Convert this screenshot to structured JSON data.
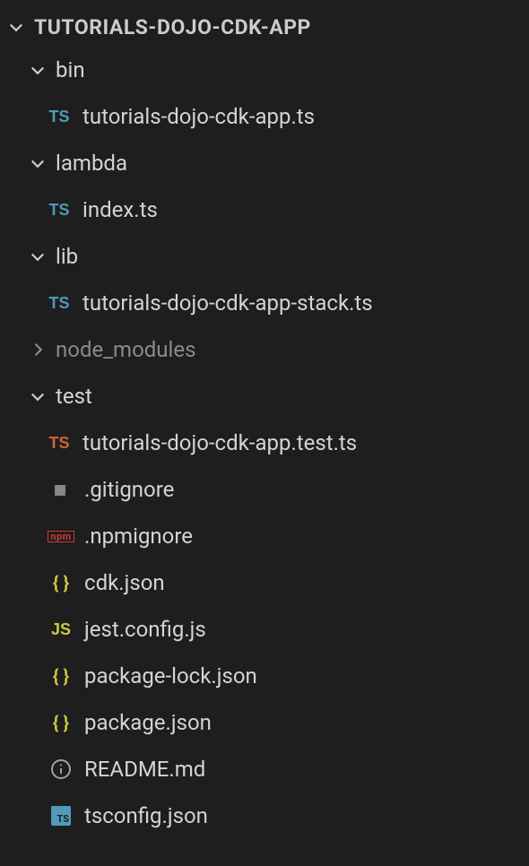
{
  "root": {
    "name": "TUTORIALS-DOJO-CDK-APP"
  },
  "items": [
    {
      "type": "folder",
      "name": "bin",
      "expanded": true
    },
    {
      "type": "file",
      "name": "tutorials-dojo-cdk-app.ts",
      "icon": "ts",
      "parent": "bin"
    },
    {
      "type": "folder",
      "name": "lambda",
      "expanded": true
    },
    {
      "type": "file",
      "name": "index.ts",
      "icon": "ts",
      "parent": "lambda"
    },
    {
      "type": "folder",
      "name": "lib",
      "expanded": true
    },
    {
      "type": "file",
      "name": "tutorials-dojo-cdk-app-stack.ts",
      "icon": "ts",
      "parent": "lib"
    },
    {
      "type": "folder",
      "name": "node_modules",
      "expanded": false,
      "muted": true
    },
    {
      "type": "folder",
      "name": "test",
      "expanded": true
    },
    {
      "type": "file",
      "name": "tutorials-dojo-cdk-app.test.ts",
      "icon": "ts-test",
      "parent": "test"
    },
    {
      "type": "file",
      "name": ".gitignore",
      "icon": "git"
    },
    {
      "type": "file",
      "name": ".npmignore",
      "icon": "npm"
    },
    {
      "type": "file",
      "name": "cdk.json",
      "icon": "json"
    },
    {
      "type": "file",
      "name": "jest.config.js",
      "icon": "js"
    },
    {
      "type": "file",
      "name": "package-lock.json",
      "icon": "json"
    },
    {
      "type": "file",
      "name": "package.json",
      "icon": "json"
    },
    {
      "type": "file",
      "name": "README.md",
      "icon": "info"
    },
    {
      "type": "file",
      "name": "tsconfig.json",
      "icon": "tsfile"
    }
  ],
  "iconText": {
    "ts": "TS",
    "ts-test": "TS",
    "js": "JS",
    "json": "{ }",
    "npm": "npm",
    "tsfile": "TS"
  }
}
